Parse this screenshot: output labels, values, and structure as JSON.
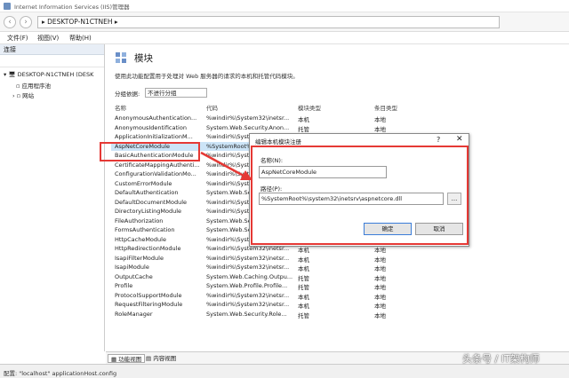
{
  "window": {
    "title": "Internet Information Services (IIS)管理器"
  },
  "address": {
    "crumb": "DESKTOP-N1CTNEH",
    "sep": "▸"
  },
  "menu": [
    "文件(F)",
    "视图(V)",
    "帮助(H)"
  ],
  "left": {
    "header": "连接",
    "tree": [
      "DESKTOP-N1CTNEH (DESK",
      "应用程序池",
      "网站"
    ]
  },
  "main": {
    "title": "模块",
    "description": "使用此功能配置用于处理对 Web 服务器的请求的本机和托管代码模块。",
    "group_label": "分组依据:",
    "group_value": "不进行分组",
    "columns": [
      "名称",
      "代码",
      "模块类型",
      "条目类型"
    ],
    "rows": [
      {
        "name": "AnonymousAuthentication...",
        "code": "%windir%\\System32\\inetsr...",
        "type": "本机",
        "entry": "本地"
      },
      {
        "name": "AnonymousIdentification",
        "code": "System.Web.Security.Anon...",
        "type": "托管",
        "entry": "本地"
      },
      {
        "name": "ApplicationInitializationM...",
        "code": "%windir%\\System32\\inetsr...",
        "type": "本机",
        "entry": "本地"
      },
      {
        "name": "AspNetCoreModule",
        "code": "%SystemRoot%\\system32\\...",
        "type": "本机",
        "entry": "本地"
      },
      {
        "name": "BasicAuthenticationModule",
        "code": "%windir%\\System32\\inetsr...",
        "type": "本机",
        "entry": "本地"
      },
      {
        "name": "CertificateMappingAuthenti...",
        "code": "%windir%\\System32\\inetsr...",
        "type": "本机",
        "entry": "本地"
      },
      {
        "name": "ConfigurationValidationMo...",
        "code": "%windir%\\System32\\inetsr...",
        "type": "本机",
        "entry": "本地"
      },
      {
        "name": "CustomErrorModule",
        "code": "%windir%\\System32\\inetsr...",
        "type": "本机",
        "entry": "本地"
      },
      {
        "name": "DefaultAuthentication",
        "code": "System.Web.Security.Defa...",
        "type": "托管",
        "entry": "本地"
      },
      {
        "name": "DefaultDocumentModule",
        "code": "%windir%\\System32\\inetsr...",
        "type": "本机",
        "entry": "本地"
      },
      {
        "name": "DirectoryListingModule",
        "code": "%windir%\\System32\\inetsr...",
        "type": "本机",
        "entry": "本地"
      },
      {
        "name": "FileAuthorization",
        "code": "System.Web.Security.FileA...",
        "type": "托管",
        "entry": "本地"
      },
      {
        "name": "FormsAuthentication",
        "code": "System.Web.Security.Form...",
        "type": "托管",
        "entry": "本地"
      },
      {
        "name": "HttpCacheModule",
        "code": "%windir%\\System32\\inetsr...",
        "type": "本机",
        "entry": "本地"
      },
      {
        "name": "HttpRedirectionModule",
        "code": "%windir%\\System32\\inetsr...",
        "type": "本机",
        "entry": "本地"
      },
      {
        "name": "IsapiFilterModule",
        "code": "%windir%\\System32\\inetsr...",
        "type": "本机",
        "entry": "本地"
      },
      {
        "name": "IsapiModule",
        "code": "%windir%\\System32\\inetsr...",
        "type": "本机",
        "entry": "本地"
      },
      {
        "name": "OutputCache",
        "code": "System.Web.Caching.Outpu...",
        "type": "托管",
        "entry": "本地"
      },
      {
        "name": "Profile",
        "code": "System.Web.Profile.Profile...",
        "type": "托管",
        "entry": "本地"
      },
      {
        "name": "ProtocolSupportModule",
        "code": "%windir%\\System32\\inetsr...",
        "type": "本机",
        "entry": "本地"
      },
      {
        "name": "RequestFilteringModule",
        "code": "%windir%\\System32\\inetsr...",
        "type": "本机",
        "entry": "本地"
      },
      {
        "name": "RoleManager",
        "code": "System.Web.Security.Role...",
        "type": "托管",
        "entry": "本地"
      }
    ]
  },
  "dialog": {
    "title": "编辑本机模块注册",
    "help": "?",
    "close": "✕",
    "name_label": "名称(N):",
    "name_value": "AspNetCoreModule",
    "path_label": "路径(P):",
    "path_value": "%SystemRoot%\\system32\\inetsrv\\aspnetcore.dll",
    "browse": "...",
    "ok": "确定",
    "cancel": "取消"
  },
  "tabs": [
    "功能视图",
    "内容视图"
  ],
  "status": "配置: \"localhost\" applicationHost.config",
  "watermark": "头条号 / IT架构师",
  "colors": {
    "highlight": "#e53935",
    "selected_row": "#cce4f7"
  }
}
